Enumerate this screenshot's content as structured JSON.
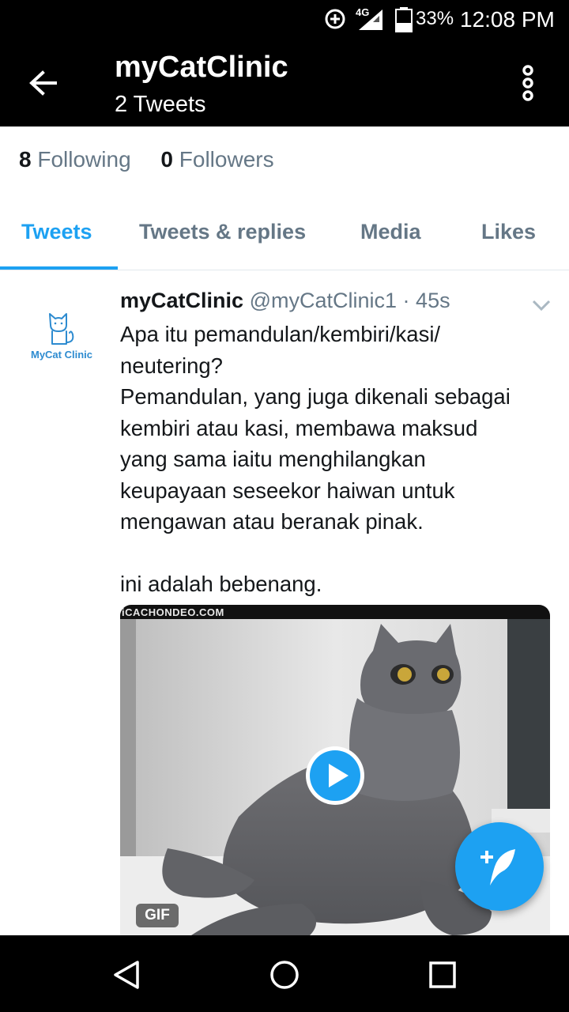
{
  "status_bar": {
    "network": "4G",
    "battery": "33%",
    "time": "12:08 PM",
    "icons": [
      "data-saver-icon",
      "signal-icon",
      "battery-icon"
    ]
  },
  "app_bar": {
    "title": "myCatClinic",
    "subtitle": "2 Tweets",
    "icons": [
      "back-arrow-icon",
      "more-vert-icon"
    ]
  },
  "stats": {
    "following_count": "8",
    "following_label": "Following",
    "followers_count": "0",
    "followers_label": "Followers"
  },
  "tabs": [
    {
      "label": "Tweets",
      "active": true
    },
    {
      "label": "Tweets & replies",
      "active": false
    },
    {
      "label": "Media",
      "active": false
    },
    {
      "label": "Likes",
      "active": false
    }
  ],
  "tweet": {
    "avatar_text": "MyCat Clinic",
    "name": "myCatClinic",
    "handle": "@myCatClinic1",
    "separator": "·",
    "age": "45s",
    "lines": [
      "Apa itu pemandulan/kembiri/kasi/",
      "neutering?",
      "Pemandulan, yang juga dikenali sebagai",
      "kembiri atau kasi, membawa maksud",
      "yang sama iaitu menghilangkan",
      "keupayaan seseekor haiwan untuk",
      "mengawan atau beranak pinak."
    ],
    "closing_line": "ini adalah bebenang.",
    "media": {
      "source_watermark": "iCACHONDEO.COM",
      "badge": "GIF"
    }
  },
  "colors": {
    "accent": "#1da1f2",
    "secondary_text": "#657786",
    "primary_text": "#14171a",
    "bar_bg": "#000000"
  }
}
